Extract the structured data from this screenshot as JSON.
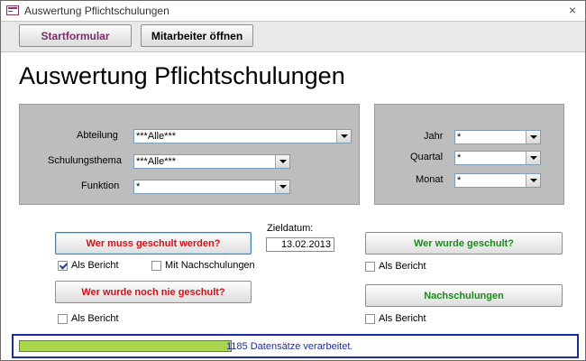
{
  "window": {
    "title": "Auswertung Pflichtschulungen",
    "close_glyph": "×"
  },
  "toolbar": {
    "startformular_label": "Startformular",
    "mitarbeiter_label": "Mitarbeiter öffnen"
  },
  "page": {
    "title": "Auswertung Pflichtschulungen"
  },
  "filters_left": {
    "abteilung_label": "Abteilung",
    "abteilung_value": "***Alle***",
    "schulungsthema_label": "Schulungsthema",
    "schulungsthema_value": "***Alle***",
    "funktion_label": "Funktion",
    "funktion_value": "*"
  },
  "filters_right": {
    "jahr_label": "Jahr",
    "jahr_value": "*",
    "quartal_label": "Quartal",
    "quartal_value": "*",
    "monat_label": "Monat",
    "monat_value": "*"
  },
  "zieldatum": {
    "label": "Zieldatum:",
    "value": "13.02.2013"
  },
  "actions": {
    "wer_muss_label": "Wer muss geschult werden?",
    "als_bericht_1": "Als Bericht",
    "als_bericht_1_checked": true,
    "mit_nachschulungen": "Mit Nachschulungen",
    "mit_nachschulungen_checked": false,
    "wer_nie_label": "Wer wurde noch nie geschult?",
    "als_bericht_2": "Als Bericht",
    "als_bericht_2_checked": false,
    "wer_wurde_label": "Wer wurde geschult?",
    "als_bericht_3": "Als Bericht",
    "als_bericht_3_checked": false,
    "nachschulungen_label": "Nachschulungen",
    "als_bericht_4": "Als Bericht",
    "als_bericht_4_checked": false
  },
  "status": {
    "text": "1185 Datensätze verarbeitet.",
    "progress_fraction": 1.0
  },
  "colors": {
    "accent_red": "#d0101a",
    "accent_green": "#1a8a1a",
    "progress_green": "#a8d44e",
    "status_border": "#1f2a9a"
  }
}
